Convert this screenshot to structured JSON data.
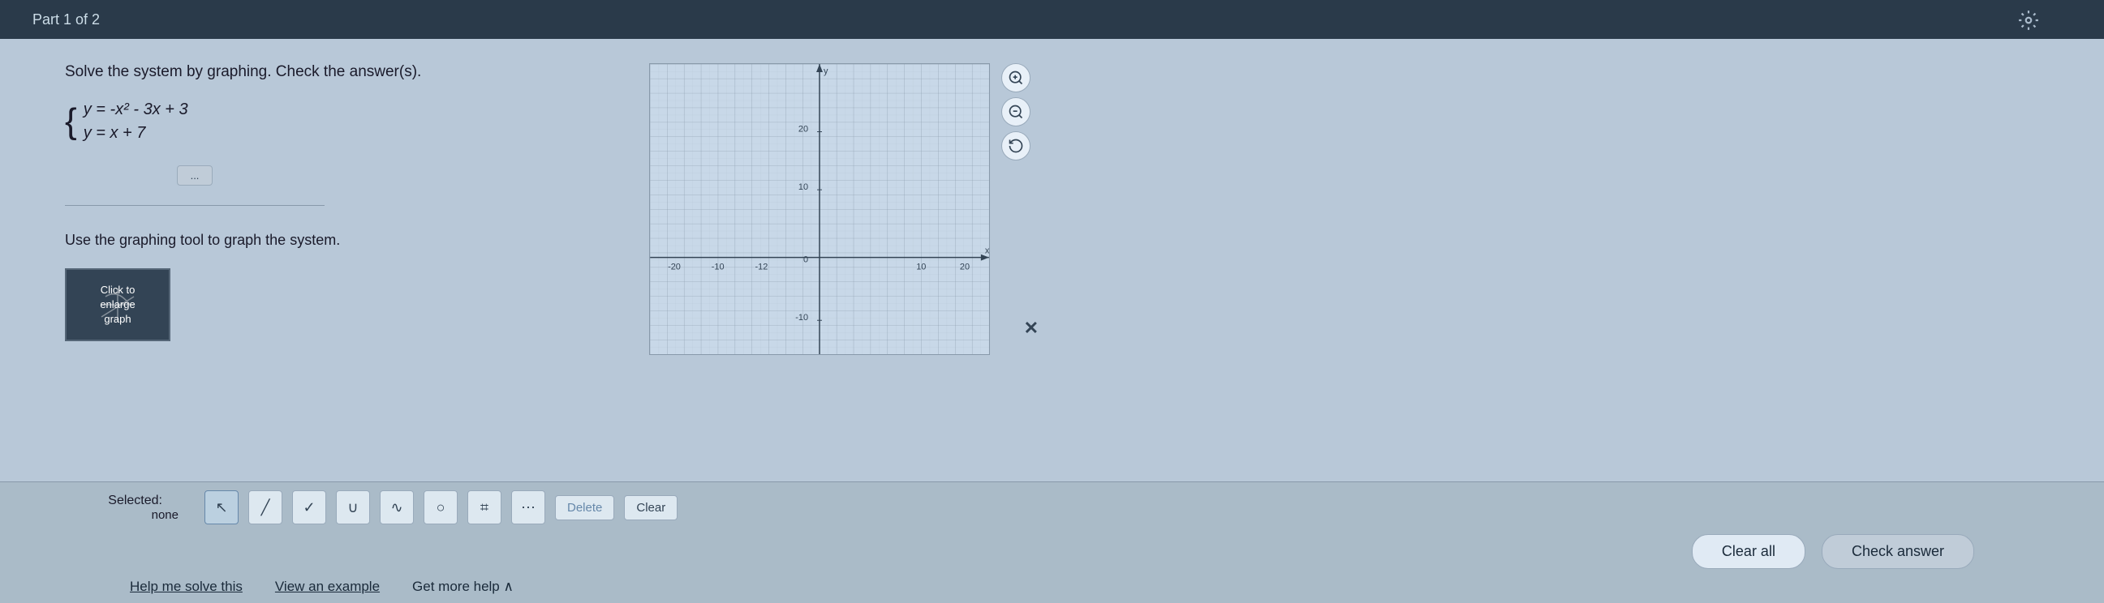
{
  "header": {
    "part_label": "Part 1 of 2"
  },
  "problem": {
    "instruction": "Solve the system by graphing. Check the answer(s).",
    "equations": [
      "y = -x² - 3x + 3",
      "y = x + 7"
    ],
    "expand_button_label": "...",
    "graphing_instruction": "Use the graphing tool to graph the system.",
    "thumbnail": {
      "label_line1": "Click to",
      "label_line2": "enlarge",
      "label_line3": "graph"
    }
  },
  "graph": {
    "y_axis_label": "y",
    "x_axis_label": "x",
    "y_max": 20,
    "y_min": -10,
    "x_max": 20,
    "x_min": -20
  },
  "toolbar": {
    "selected_label": "Selected:",
    "selected_value": "none",
    "tools": [
      {
        "name": "pointer",
        "symbol": "↖",
        "title": "Pointer"
      },
      {
        "name": "line",
        "symbol": "╱",
        "title": "Line"
      },
      {
        "name": "checkmark",
        "symbol": "✓",
        "title": "Check"
      },
      {
        "name": "union",
        "symbol": "∪",
        "title": "Union"
      },
      {
        "name": "wave",
        "symbol": "∿",
        "title": "Wave"
      },
      {
        "name": "circle",
        "symbol": "○",
        "title": "Circle"
      },
      {
        "name": "region",
        "symbol": "⌗",
        "title": "Region"
      },
      {
        "name": "dots",
        "symbol": "⋯",
        "title": "Dots"
      }
    ],
    "delete_label": "Delete",
    "clear_label": "Clear"
  },
  "actions": {
    "clear_all_label": "Clear all",
    "check_answer_label": "Check answer"
  },
  "footer": {
    "help_link": "Help me solve this",
    "example_link": "View an example",
    "more_help": "Get more help ∧"
  },
  "zoom_controls": {
    "zoom_in": "🔍",
    "zoom_out": "🔍",
    "reset": "⟲"
  },
  "icons": {
    "settings": "⚙",
    "close": "✕",
    "zoom_in_symbol": "+",
    "zoom_out_symbol": "-",
    "reset_symbol": "↺"
  }
}
